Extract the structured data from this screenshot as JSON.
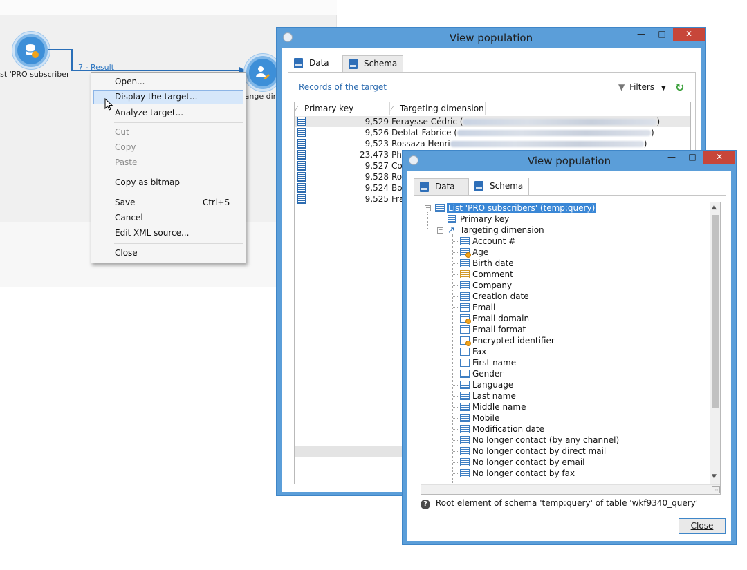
{
  "workflow": {
    "source_node_label": "List 'PRO subscribers'",
    "transition_label": "7 - Result",
    "target_node_label": "Change dimension"
  },
  "context_menu": {
    "items": [
      {
        "label": "Open...",
        "state": "normal"
      },
      {
        "label": "Display the target...",
        "state": "highlighted"
      },
      {
        "label": "Analyze target...",
        "state": "normal"
      },
      {
        "label": "Cut",
        "state": "disabled"
      },
      {
        "label": "Copy",
        "state": "disabled"
      },
      {
        "label": "Paste",
        "state": "disabled"
      },
      {
        "label": "Copy as bitmap",
        "state": "normal"
      },
      {
        "label": "Save",
        "shortcut": "Ctrl+S",
        "state": "normal"
      },
      {
        "label": "Cancel",
        "state": "normal"
      },
      {
        "label": "Edit XML source...",
        "state": "normal"
      },
      {
        "label": "Close",
        "state": "normal"
      }
    ]
  },
  "window1": {
    "title": "View population",
    "tabs": [
      "Data",
      "Schema"
    ],
    "active_tab": "Data",
    "section_title": "Records of the target",
    "filters_label": "Filters",
    "columns": [
      "Primary key",
      "Targeting dimension"
    ],
    "rows": [
      {
        "key": "9,529",
        "name": "Feraysse Cédric (",
        "tail": ")"
      },
      {
        "key": "9,526",
        "name": "Deblat Fabrice (",
        "tail": ")"
      },
      {
        "key": "9,523",
        "name": "Rossaza Henri",
        "tail": ")"
      },
      {
        "key": "23,473",
        "name": "Ph",
        "tail": ""
      },
      {
        "key": "9,527",
        "name": "Co",
        "tail": ""
      },
      {
        "key": "9,528",
        "name": "Ro",
        "tail": ""
      },
      {
        "key": "9,524",
        "name": "Bo",
        "tail": ""
      },
      {
        "key": "9,525",
        "name": "Fra",
        "tail": ""
      }
    ]
  },
  "window2": {
    "title": "View population",
    "tabs": [
      "Data",
      "Schema"
    ],
    "active_tab": "Schema",
    "root_label": "List 'PRO subscribers' (temp:query)",
    "primary_key_label": "Primary key",
    "targeting_label": "Targeting dimension",
    "fields": [
      {
        "label": "Account #",
        "icon": "plain"
      },
      {
        "label": "Age",
        "icon": "computed"
      },
      {
        "label": "Birth date",
        "icon": "plain"
      },
      {
        "label": "Comment",
        "icon": "memo"
      },
      {
        "label": "Company",
        "icon": "plain"
      },
      {
        "label": "Creation date",
        "icon": "plain"
      },
      {
        "label": "Email",
        "icon": "plain"
      },
      {
        "label": "Email domain",
        "icon": "computed"
      },
      {
        "label": "Email format",
        "icon": "plain"
      },
      {
        "label": "Encrypted identifier",
        "icon": "computed"
      },
      {
        "label": "Fax",
        "icon": "plain"
      },
      {
        "label": "First name",
        "icon": "plain"
      },
      {
        "label": "Gender",
        "icon": "plain"
      },
      {
        "label": "Language",
        "icon": "plain"
      },
      {
        "label": "Last name",
        "icon": "plain"
      },
      {
        "label": "Middle name",
        "icon": "plain"
      },
      {
        "label": "Mobile",
        "icon": "plain"
      },
      {
        "label": "Modification date",
        "icon": "plain"
      },
      {
        "label": "No longer contact (by any channel)",
        "icon": "plain"
      },
      {
        "label": "No longer contact by direct mail",
        "icon": "plain"
      },
      {
        "label": "No longer contact by email",
        "icon": "plain"
      },
      {
        "label": "No longer contact by fax",
        "icon": "plain"
      }
    ],
    "status_text": "Root element of schema 'temp:query' of table 'wkf9340_query'",
    "close_button": "Close"
  }
}
